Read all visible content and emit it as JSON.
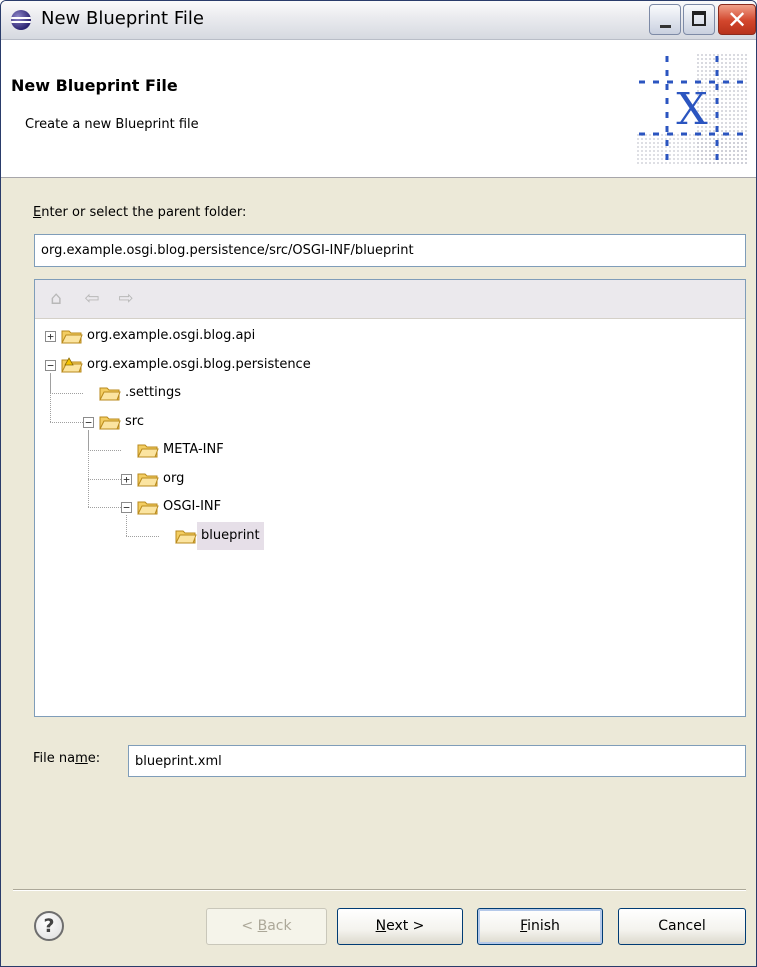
{
  "window": {
    "title": "New Blueprint File"
  },
  "banner": {
    "title": "New Blueprint File",
    "description": "Create a new Blueprint file"
  },
  "folder_prompt": {
    "accel": "E",
    "rest": "nter or select the parent folder:"
  },
  "parent_folder_value": "org.example.osgi.blog.persistence/src/OSGI-INF/blueprint",
  "tree_toolbar": {
    "icons": [
      "home-icon",
      "back-arrow-icon",
      "forward-arrow-icon"
    ]
  },
  "tree": [
    {
      "label": "org.example.osgi.blog.api",
      "depth": 0,
      "expander": "+",
      "icon": "project-folder-icon"
    },
    {
      "label": "org.example.osgi.blog.persistence",
      "depth": 0,
      "expander": "-",
      "icon": "project-folder-warning-icon"
    },
    {
      "label": ".settings",
      "depth": 1,
      "expander": "",
      "icon": "folder-icon"
    },
    {
      "label": "src",
      "depth": 1,
      "expander": "-",
      "icon": "folder-icon"
    },
    {
      "label": "META-INF",
      "depth": 2,
      "expander": "",
      "icon": "folder-icon"
    },
    {
      "label": "org",
      "depth": 2,
      "expander": "+",
      "icon": "folder-icon"
    },
    {
      "label": "OSGI-INF",
      "depth": 2,
      "expander": "-",
      "icon": "folder-icon"
    },
    {
      "label": "blueprint",
      "depth": 3,
      "expander": "",
      "icon": "folder-icon",
      "selected": true
    }
  ],
  "file_name": {
    "label_pre": "File na",
    "label_accel": "m",
    "label_post": "e:",
    "value": "blueprint.xml"
  },
  "buttons": {
    "back": {
      "pre": "< ",
      "accel": "B",
      "post": "ack",
      "enabled": false
    },
    "next": {
      "pre": "",
      "accel": "N",
      "post": "ext >",
      "enabled": true
    },
    "finish": {
      "pre": "",
      "accel": "F",
      "post": "inish",
      "enabled": true
    },
    "cancel": {
      "label": "Cancel",
      "enabled": true
    }
  },
  "colors": {
    "selection": "#e6dfe8",
    "folder_fill": "#f7d77a",
    "folder_stroke": "#b98a1c",
    "window_face": "#ece9d8"
  }
}
